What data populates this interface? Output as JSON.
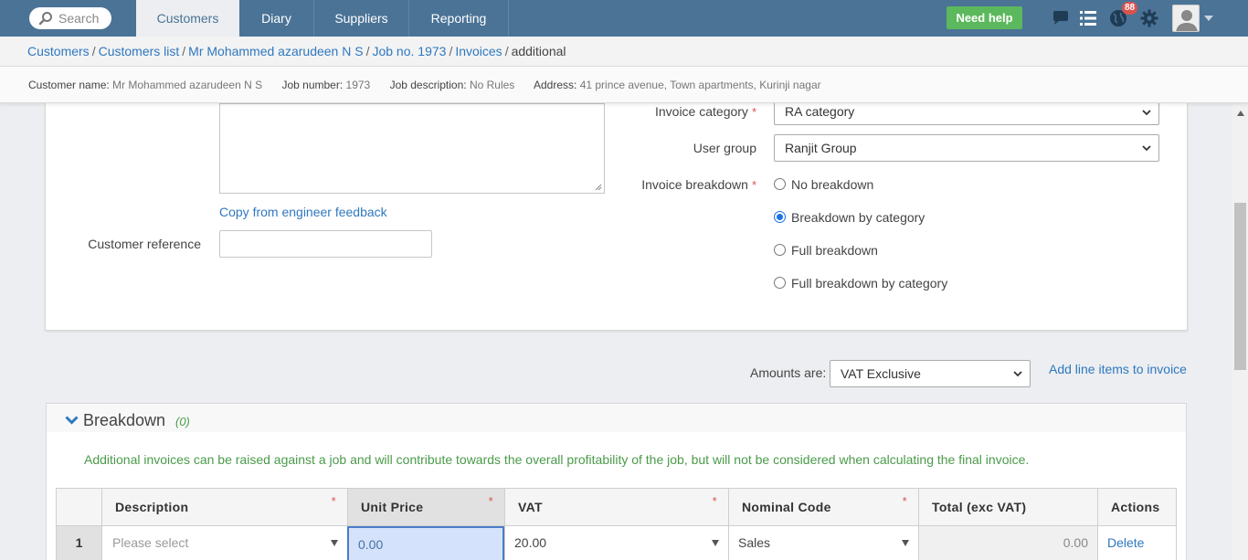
{
  "nav": {
    "search_placeholder": "Search",
    "tabs": [
      {
        "label": "Customers"
      },
      {
        "label": "Diary"
      },
      {
        "label": "Suppliers"
      },
      {
        "label": "Reporting"
      }
    ],
    "need_help": "Need help",
    "notification_count": "88",
    "active_color": "#4a7396"
  },
  "breadcrumb": {
    "items": [
      "Customers",
      "Customers list",
      "Mr Mohammed azarudeen N S",
      "Job no. 1973",
      "Invoices"
    ],
    "current": "additional",
    "separator": "/"
  },
  "info": {
    "customer_name_label": "Customer name:",
    "customer_name": "Mr Mohammed azarudeen N S",
    "job_number_label": "Job number:",
    "job_number": "1973",
    "job_description_label": "Job description:",
    "job_description": "No Rules",
    "address_label": "Address:",
    "address": "41 prince avenue, Town apartments, Kurinji nagar"
  },
  "form": {
    "copy_link": "Copy from engineer feedback",
    "customer_reference_label": "Customer reference",
    "customer_reference_value": "",
    "invoice_category_label": "Invoice category",
    "invoice_category_value": "RA category",
    "user_group_label": "User group",
    "user_group_value": "Ranjit Group",
    "invoice_breakdown_label": "Invoice breakdown",
    "required_mark": "*",
    "breakdown_options": [
      {
        "label": "No breakdown",
        "selected": false
      },
      {
        "label": "Breakdown by category",
        "selected": true
      },
      {
        "label": "Full breakdown",
        "selected": false
      },
      {
        "label": "Full breakdown by category",
        "selected": false
      }
    ]
  },
  "amounts": {
    "label": "Amounts are:",
    "value": "VAT Exclusive",
    "add_link": "Add line items to invoice"
  },
  "breakdown": {
    "title": "Breakdown",
    "count": "(0)",
    "note": "Additional invoices can be raised against a job and will contribute towards the overall profitability of the job, but will not be considered when calculating the final invoice.",
    "columns": [
      "Description",
      "Unit Price",
      "VAT",
      "Nominal Code",
      "Total (exc VAT)",
      "Actions"
    ],
    "rows": [
      {
        "num": "1",
        "description": "Please select",
        "unit_price": "0.00",
        "vat": "20.00",
        "nominal_code": "Sales",
        "total": "0.00",
        "action": "Delete"
      }
    ]
  }
}
